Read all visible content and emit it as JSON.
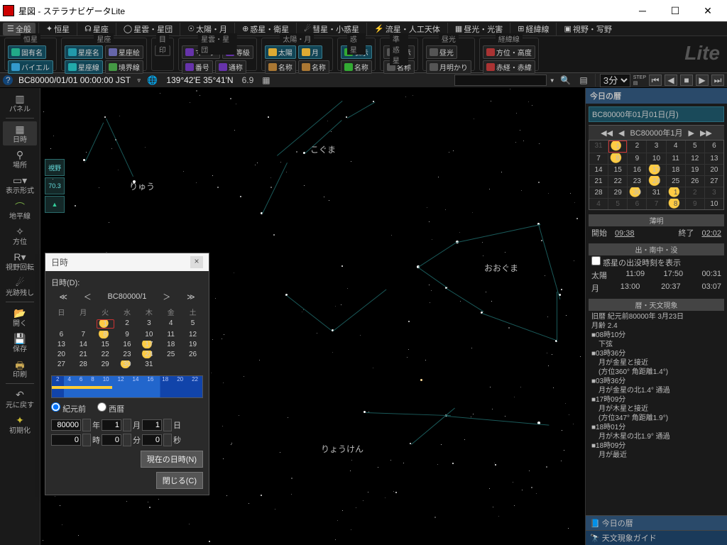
{
  "window": {
    "title": "星図 - ステラナビゲータLite"
  },
  "tabs": {
    "general": "全般",
    "stars": "恒星",
    "const": "星座",
    "cluster": "星雲・星団",
    "sunmoon": "太陽・月",
    "planets": "惑星・衛星",
    "comets": "彗星・小惑星",
    "meteor": "流星・人工天体",
    "daylight": "昼光・光害",
    "grid": "経緯線",
    "view": "視野・写野"
  },
  "fieldsets": {
    "f1": {
      "legend": "恒星",
      "b1": "固有名",
      "b2": "バイエル"
    },
    "f2": {
      "legend": "星座",
      "b1": "星座名",
      "b2": "星座絵",
      "b3": "星座線",
      "b4": "境界線"
    },
    "f3": {
      "legend": "目印"
    },
    "f4": {
      "legend": "星雲・星団",
      "b1": "マーク",
      "b2": "等級",
      "b3": "番号",
      "b4": "通称"
    },
    "f5": {
      "legend": "太陽・月",
      "b1": "太陽",
      "b2": "月",
      "b3": "名称",
      "b4": "名称"
    },
    "f6": {
      "legend": "惑星",
      "b1": "表示",
      "b2": "名称"
    },
    "f7": {
      "legend": "準惑星",
      "b1": "表示",
      "b2": "名称"
    },
    "f8": {
      "legend": "昼光",
      "b1": "昼光",
      "b2": "月明かり"
    },
    "f9": {
      "legend": "経緯線",
      "b1": "方位・高度",
      "b2": "赤経・赤緯"
    },
    "logo": "Lite"
  },
  "status": {
    "datetime": "BC80000/01/01 00:00:00 JST",
    "coords": "139°42'E 35°41'N",
    "zoom": "6.9",
    "step": "3分"
  },
  "leftbar": {
    "panel": "パネル",
    "datetime": "日時",
    "place": "場所",
    "display": "表示形式",
    "horizon": "地平線",
    "direction": "方位",
    "rot": "視野回転",
    "trail": "光跡残し",
    "open": "開く",
    "save": "保存",
    "print": "印刷",
    "undo": "元に戻す",
    "init": "初期化"
  },
  "constellations": {
    "koguma": "こぐま",
    "ryuu": "りゅう",
    "ooguma": "おおぐま",
    "ryouken": "りょうけん"
  },
  "skytool": {
    "fov": "視野",
    "val": "70.3"
  },
  "rightpanel": {
    "title": "今日の暦",
    "date": "BC80000年01月01日(月)",
    "month_label": "BC80000年1月",
    "twilight": {
      "title": "薄明",
      "start_l": "開始",
      "start": "09:38",
      "end_l": "終了",
      "end": "02:02"
    },
    "rise": {
      "title": "出・南中・没",
      "chk": "惑星の出没時刻を表示",
      "sun_l": "太陽",
      "sun": [
        "11:09",
        "17:50",
        "00:31"
      ],
      "moon_l": "月",
      "moon": [
        "13:00",
        "20:37",
        "03:07"
      ]
    },
    "astro": {
      "title": "暦・天文現象",
      "old": "旧暦 紀元前80000年 3月23日",
      "age": "月齢 2.4",
      "events": [
        "■08時10分",
        "　下弦",
        "■03時36分",
        "　月が金星と接近",
        "　(方位360° 角距離1.4°)",
        "■03時36分",
        "　月が金星の北1.4° 通過",
        "■17時09分",
        "　月が木星と接近",
        "　(方位347° 角距離1.9°)",
        "■18時01分",
        "　月が木星の北1.9° 通過",
        "■18時09分",
        "　月が最近"
      ]
    },
    "tab1": "今日の暦",
    "tab2": "天文現象ガイド"
  },
  "cal": {
    "row_prev": [
      "31",
      "1",
      "2",
      "3",
      "4",
      "5",
      "6"
    ],
    "rows": [
      [
        "7",
        "8",
        "9",
        "10",
        "11",
        "12",
        "13"
      ],
      [
        "14",
        "15",
        "16",
        "17",
        "18",
        "19",
        "20"
      ],
      [
        "21",
        "22",
        "23",
        "24",
        "25",
        "26",
        "27"
      ],
      [
        "28",
        "29",
        "30",
        "31",
        "1",
        "2",
        "3"
      ],
      [
        "4",
        "5",
        "6",
        "7",
        "8",
        "9",
        "10"
      ]
    ]
  },
  "dialog": {
    "title": "日時",
    "label": "日時(D):",
    "month": "BC80000/1",
    "dow": [
      "日",
      "月",
      "火",
      "水",
      "木",
      "金",
      "土"
    ],
    "rows": [
      [
        "",
        "1",
        "2",
        "3",
        "4",
        "5"
      ],
      [
        "6",
        "7",
        "8",
        "9",
        "10",
        "11",
        "12"
      ],
      [
        "13",
        "14",
        "15",
        "16",
        "17",
        "18",
        "19"
      ],
      [
        "20",
        "21",
        "22",
        "23",
        "24",
        "25",
        "26"
      ],
      [
        "27",
        "28",
        "29",
        "30",
        "31",
        "",
        ""
      ]
    ],
    "tl_ticks": [
      "2",
      "4",
      "6",
      "8",
      "10",
      "12",
      "14",
      "16",
      "18",
      "20",
      "22"
    ],
    "era_bc": "紀元前",
    "era_ad": "西暦",
    "y": "80000",
    "yl": "年",
    "m": "1",
    "ml": "月",
    "d": "1",
    "dl": "日",
    "h": "0",
    "hl": "時",
    "mi": "0",
    "mil": "分",
    "s": "0",
    "sl": "秒",
    "now": "現在の日時(N)",
    "close": "閉じる(C)"
  }
}
